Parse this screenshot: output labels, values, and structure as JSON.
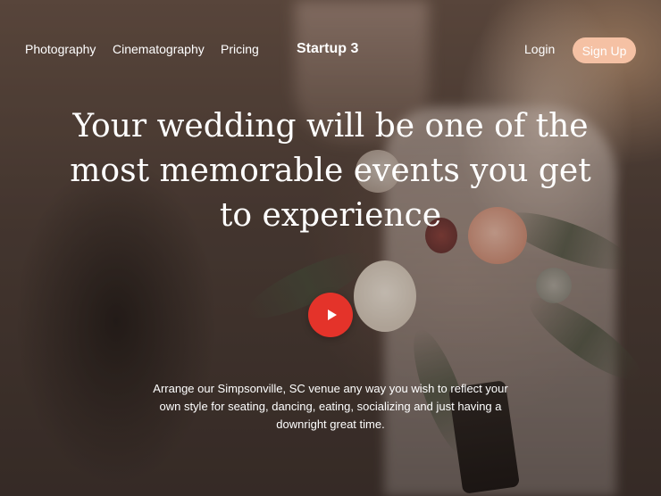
{
  "nav": {
    "links": [
      "Photography",
      "Cinematography",
      "Pricing"
    ],
    "brand": "Startup 3",
    "login_label": "Login",
    "signup_label": "Sign Up"
  },
  "hero": {
    "headline": "Your wedding will be one of the most memorable events you get to experience",
    "play_icon": "play-icon",
    "description": "Arrange our Simpsonville, SC venue any way you wish to reflect your own style for seating, dancing, eating, socializing and just having a downright great time."
  },
  "colors": {
    "signup_bg": "#f5c1a4",
    "play_bg": "#e4332a",
    "text": "#ffffff"
  }
}
